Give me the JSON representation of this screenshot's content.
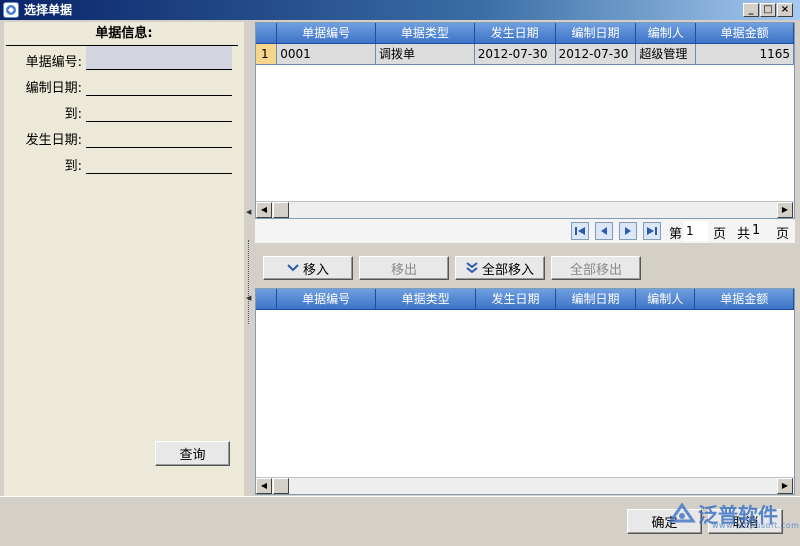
{
  "window": {
    "title": "选择单据",
    "controls": {
      "minimize": "_",
      "maximize": "□",
      "close": "×"
    }
  },
  "filter": {
    "section_title": "单据信息:",
    "fields": [
      {
        "label": "单据编号:",
        "value": ""
      },
      {
        "label": "编制日期:",
        "value": ""
      },
      {
        "label": "到:",
        "value": ""
      },
      {
        "label": "发生日期:",
        "value": ""
      },
      {
        "label": "到:",
        "value": ""
      }
    ],
    "query_button": "查询"
  },
  "top_grid": {
    "columns": [
      "",
      "单据编号",
      "单据类型",
      "发生日期",
      "编制日期",
      "编制人",
      "单据金额"
    ],
    "rows": [
      {
        "num": "1",
        "code": "0001",
        "type": "调拨单",
        "occur_date": "2012-07-30",
        "create_date": "2012-07-30",
        "creator": "超级管理",
        "amount": "1165"
      }
    ]
  },
  "pager": {
    "page_prefix": "第",
    "page_value": "1",
    "page_suffix": "页",
    "total_prefix": "共",
    "total_value": "1",
    "total_suffix": "页"
  },
  "actions": {
    "move_in": "移入",
    "move_out": "移出",
    "move_all_in": "全部移入",
    "move_all_out": "全部移出"
  },
  "bottom_grid": {
    "columns": [
      "",
      "单据编号",
      "单据类型",
      "发生日期",
      "编制日期",
      "编制人",
      "单据金额"
    ]
  },
  "footer": {
    "ok": "确定",
    "cancel": "取消"
  },
  "watermark": {
    "text": "泛普软件",
    "url": "www.fanpusoft.com"
  },
  "colors": {
    "grid_header": "#3e73c8",
    "row_number_bg": "#f7d58a",
    "accent": "#3d72c4"
  }
}
